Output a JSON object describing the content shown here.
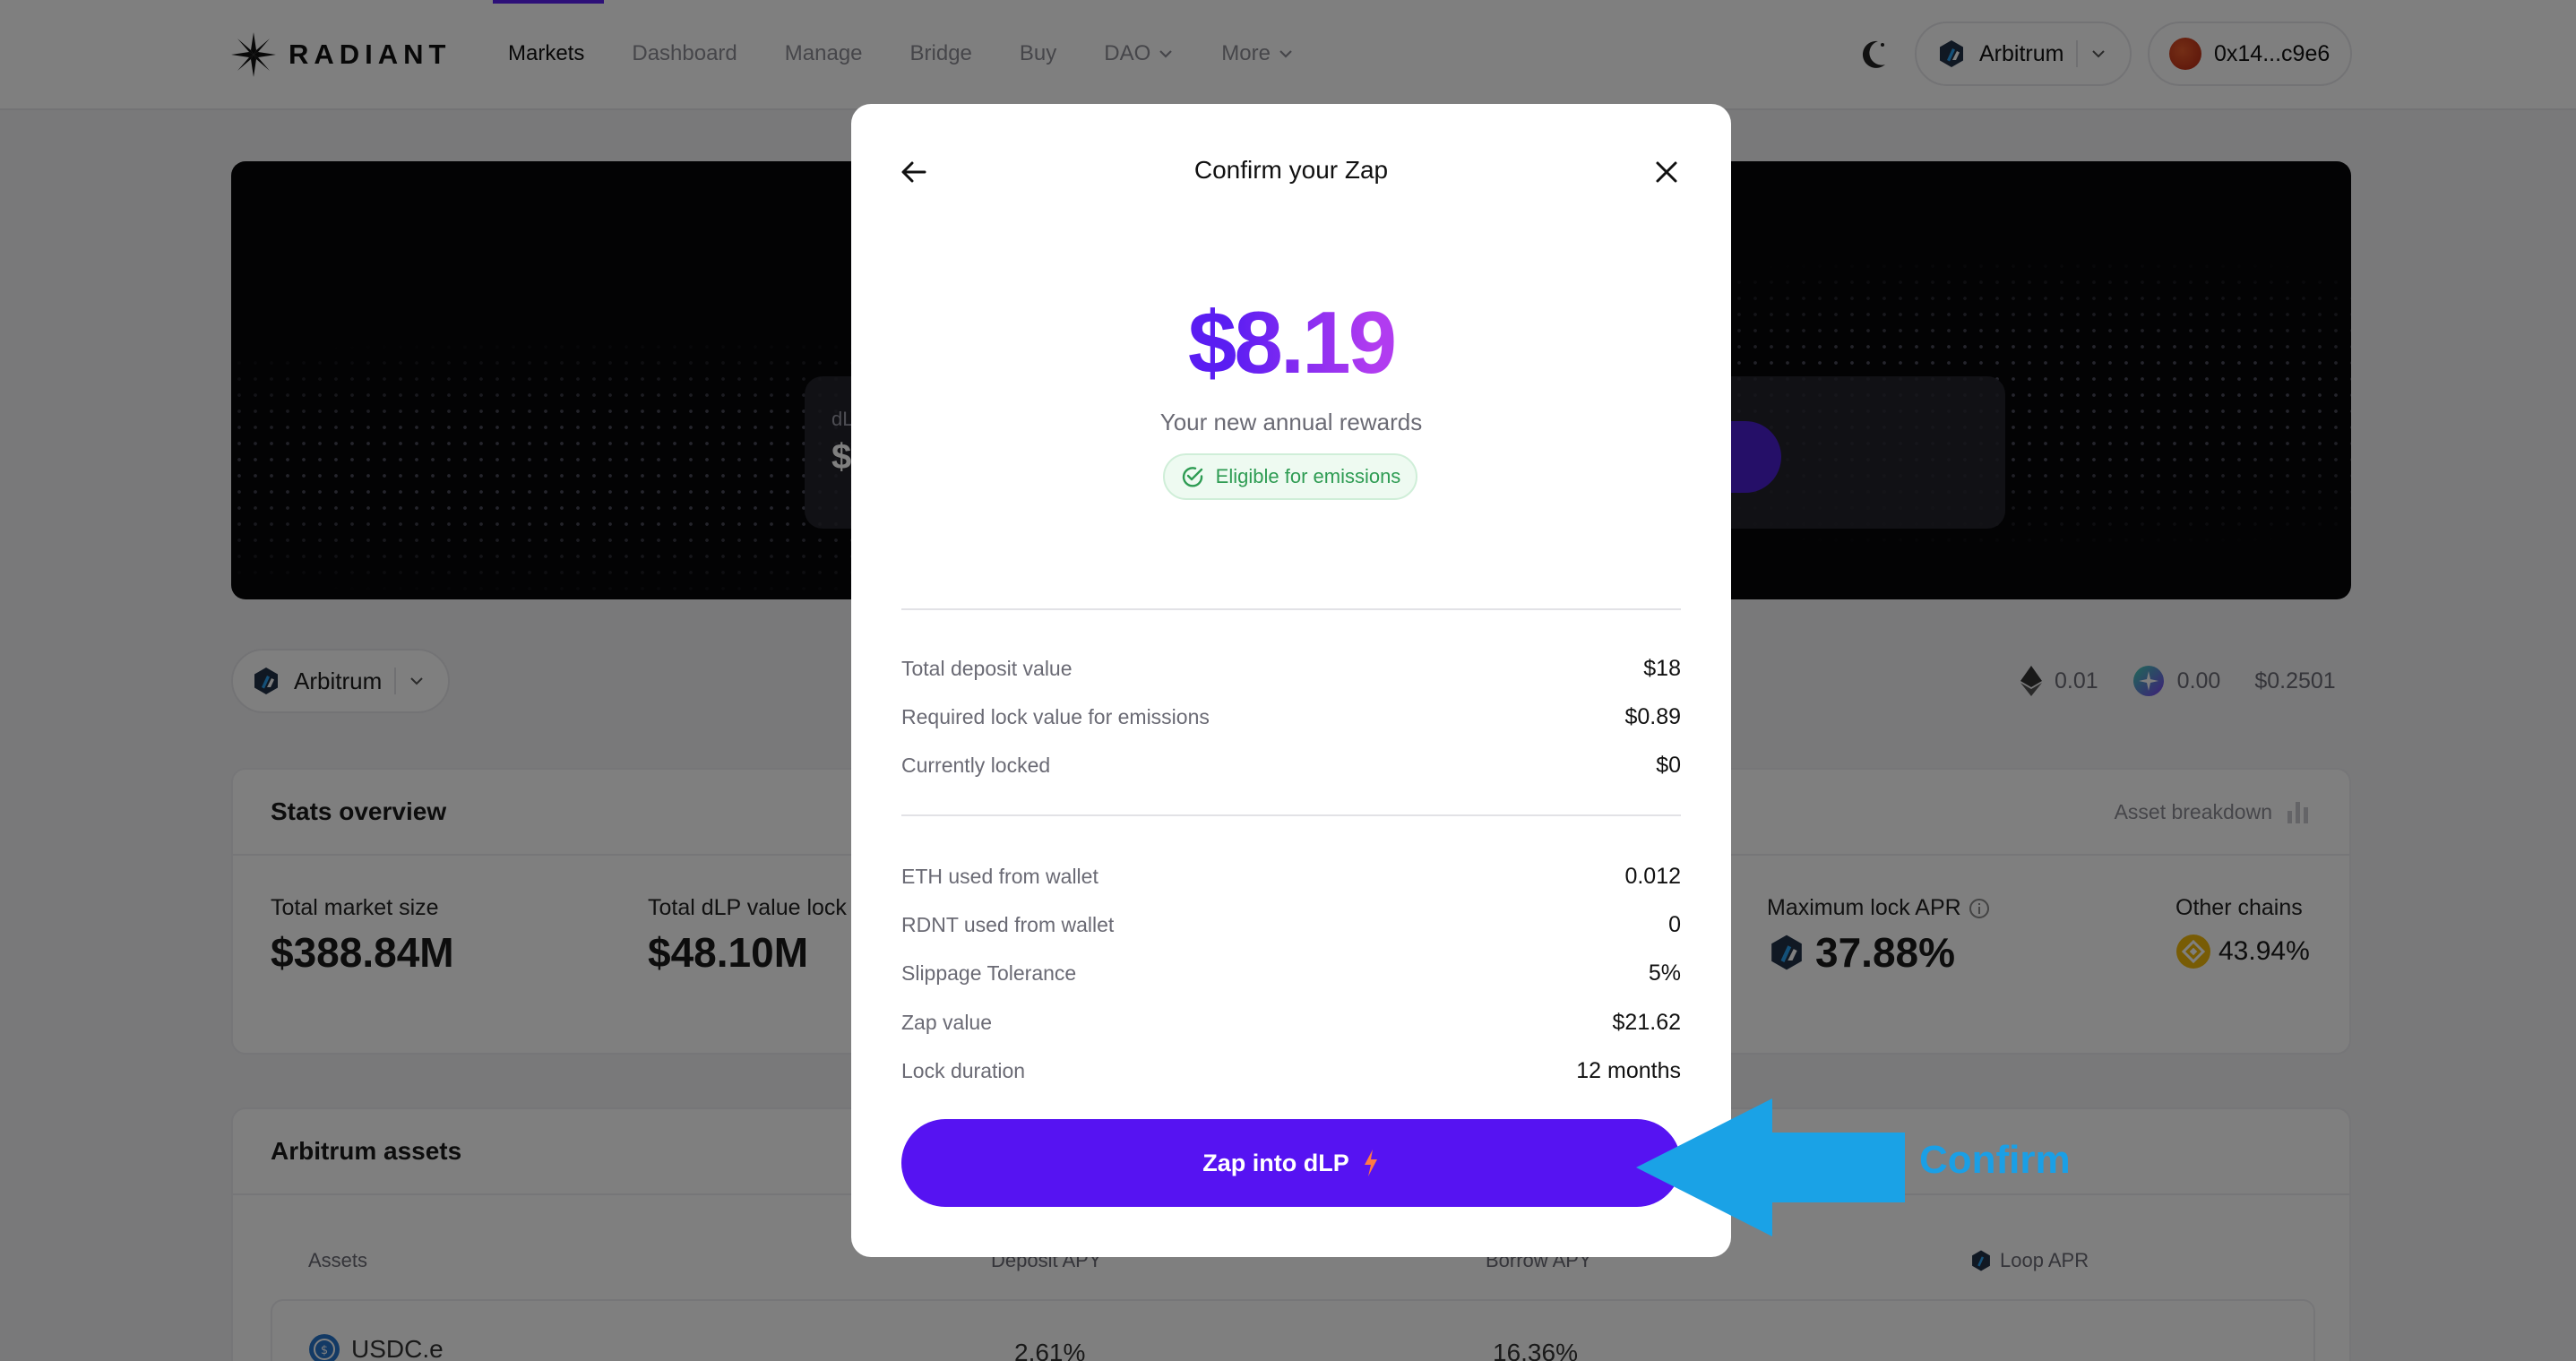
{
  "nav": {
    "brand": "RADIANT",
    "items": [
      {
        "label": "Markets",
        "active": true,
        "dropdown": false
      },
      {
        "label": "Dashboard",
        "active": false,
        "dropdown": false
      },
      {
        "label": "Manage",
        "active": false,
        "dropdown": false
      },
      {
        "label": "Bridge",
        "active": false,
        "dropdown": false
      },
      {
        "label": "Buy",
        "active": false,
        "dropdown": false
      },
      {
        "label": "DAO",
        "active": false,
        "dropdown": true
      },
      {
        "label": "More",
        "active": false,
        "dropdown": true
      }
    ],
    "network": "Arbitrum",
    "wallet": "0x14...c9e6"
  },
  "hero": {
    "card_label": "dL",
    "card_value": "$"
  },
  "filter": {
    "chain": "Arbitrum",
    "balances": [
      {
        "icon": "eth-icon",
        "value": "0.01"
      },
      {
        "icon": "rdnt-icon",
        "value": "0.00"
      },
      {
        "icon": "",
        "value": "$0.2501"
      }
    ]
  },
  "stats": {
    "title": "Stats overview",
    "asset_breakdown": "Asset breakdown",
    "items": [
      {
        "label": "Total market size",
        "value": "$388.84M"
      },
      {
        "label": "Total dLP value lock",
        "value": "$48.10M"
      },
      {
        "label": "Maximum lock APR",
        "value": "37.88%"
      },
      {
        "label": "Other chains",
        "value": "43.94%"
      }
    ]
  },
  "assets": {
    "title": "Arbitrum assets",
    "columns": [
      "Assets",
      "Deposit APY",
      "Borrow APY",
      "Loop APR"
    ],
    "rows": [
      {
        "asset": "USDC.e",
        "deposit_apy": "2.61%",
        "borrow_apy": "16.36%"
      }
    ]
  },
  "modal": {
    "title": "Confirm your Zap",
    "amount": "$8.19",
    "subtitle": "Your new annual rewards",
    "badge": "Eligible for emissions",
    "group1": [
      {
        "label": "Total deposit value",
        "value": "$18"
      },
      {
        "label": "Required lock value for emissions",
        "value": "$0.89"
      },
      {
        "label": "Currently locked",
        "value": "$0"
      }
    ],
    "group2": [
      {
        "label": "ETH used from wallet",
        "value": "0.012"
      },
      {
        "label": "RDNT used from wallet",
        "value": "0"
      },
      {
        "label": "Slippage Tolerance",
        "value": "5%"
      },
      {
        "label": "Zap value",
        "value": "$21.62"
      },
      {
        "label": "Lock duration",
        "value": "12 months"
      }
    ],
    "button": "Zap into dLP"
  },
  "annotation": {
    "label": "Confirm",
    "color": "#1a9fe6"
  },
  "colors": {
    "accent": "#5613f2",
    "success": "#2e9c53"
  }
}
